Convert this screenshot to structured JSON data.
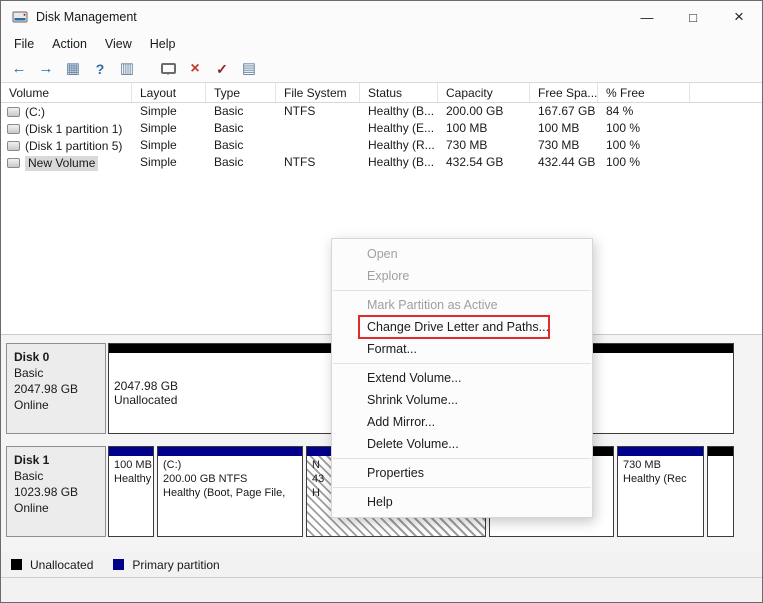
{
  "window": {
    "title": "Disk Management"
  },
  "titlebar": {
    "minimize_glyph": "—",
    "maximize_glyph": "□",
    "close_glyph": "×"
  },
  "menubar": {
    "items": [
      "File",
      "Action",
      "View",
      "Help"
    ]
  },
  "toolbar": {
    "icons": [
      {
        "name": "back-icon",
        "glyph": "←"
      },
      {
        "name": "forward-icon",
        "glyph": "→"
      },
      {
        "name": "console-tree-icon",
        "glyph": "▦"
      },
      {
        "name": "help-icon",
        "glyph": "?"
      },
      {
        "name": "action-pane-icon",
        "glyph": "▥"
      },
      {
        "name": "callout-icon",
        "glyph": ""
      },
      {
        "name": "delete-volume-icon",
        "glyph": "×"
      },
      {
        "name": "mark-partition-icon",
        "glyph": "✓"
      },
      {
        "name": "views-icon",
        "glyph": "▤"
      }
    ]
  },
  "volume_table": {
    "headers": [
      "Volume",
      "Layout",
      "Type",
      "File System",
      "Status",
      "Capacity",
      "Free Spa...",
      "% Free"
    ],
    "rows": [
      {
        "volume": "(C:)",
        "layout": "Simple",
        "type": "Basic",
        "file_system": "NTFS",
        "status": "Healthy (B...",
        "capacity": "200.00 GB",
        "free_space": "167.67 GB",
        "pct_free": "84 %"
      },
      {
        "volume": "(Disk 1 partition 1)",
        "layout": "Simple",
        "type": "Basic",
        "file_system": "",
        "status": "Healthy (E...",
        "capacity": "100 MB",
        "free_space": "100 MB",
        "pct_free": "100 %"
      },
      {
        "volume": "(Disk 1 partition 5)",
        "layout": "Simple",
        "type": "Basic",
        "file_system": "",
        "status": "Healthy (R...",
        "capacity": "730 MB",
        "free_space": "730 MB",
        "pct_free": "100 %"
      },
      {
        "volume": "New Volume",
        "layout": "Simple",
        "type": "Basic",
        "file_system": "NTFS",
        "status": "Healthy (B...",
        "capacity": "432.54 GB",
        "free_space": "432.44 GB",
        "pct_free": "100 %"
      }
    ]
  },
  "disks": [
    {
      "name": "Disk 0",
      "type": "Basic",
      "size": "2047.98 GB",
      "status": "Online",
      "partitions": [
        {
          "kind": "unallocated",
          "lines": [
            "2047.98 GB",
            "Unallocated"
          ]
        }
      ]
    },
    {
      "name": "Disk 1",
      "type": "Basic",
      "size": "1023.98 GB",
      "status": "Online",
      "partitions": [
        {
          "kind": "primary",
          "lines": [
            "100 MB",
            "Healthy"
          ]
        },
        {
          "kind": "primary",
          "lines": [
            "(C:)",
            "200.00 GB NTFS",
            "Healthy (Boot, Page File,"
          ]
        },
        {
          "kind": "primary-selected",
          "lines": [
            "N",
            "43",
            "H"
          ]
        },
        {
          "kind": "unallocated",
          "lines": []
        },
        {
          "kind": "primary",
          "lines": [
            "730 MB",
            "Healthy (Rec"
          ]
        },
        {
          "kind": "unallocated",
          "lines": []
        }
      ]
    }
  ],
  "legend": {
    "items": [
      {
        "label": "Unallocated",
        "color": "#000000"
      },
      {
        "label": "Primary partition",
        "color": "#00008b"
      }
    ]
  },
  "context_menu": {
    "highlight_color": "#e02b2b",
    "items": [
      {
        "label": "Open",
        "enabled": false
      },
      {
        "label": "Explore",
        "enabled": false
      },
      {
        "type": "separator"
      },
      {
        "label": "Mark Partition as Active",
        "enabled": false
      },
      {
        "label": "Change Drive Letter and Paths...",
        "enabled": true,
        "highlighted": true
      },
      {
        "label": "Format...",
        "enabled": true
      },
      {
        "type": "separator"
      },
      {
        "label": "Extend Volume...",
        "enabled": true
      },
      {
        "label": "Shrink Volume...",
        "enabled": true
      },
      {
        "label": "Add Mirror...",
        "enabled": true
      },
      {
        "label": "Delete Volume...",
        "enabled": true
      },
      {
        "type": "separator"
      },
      {
        "label": "Properties",
        "enabled": true
      },
      {
        "type": "separator"
      },
      {
        "label": "Help",
        "enabled": true
      }
    ]
  }
}
